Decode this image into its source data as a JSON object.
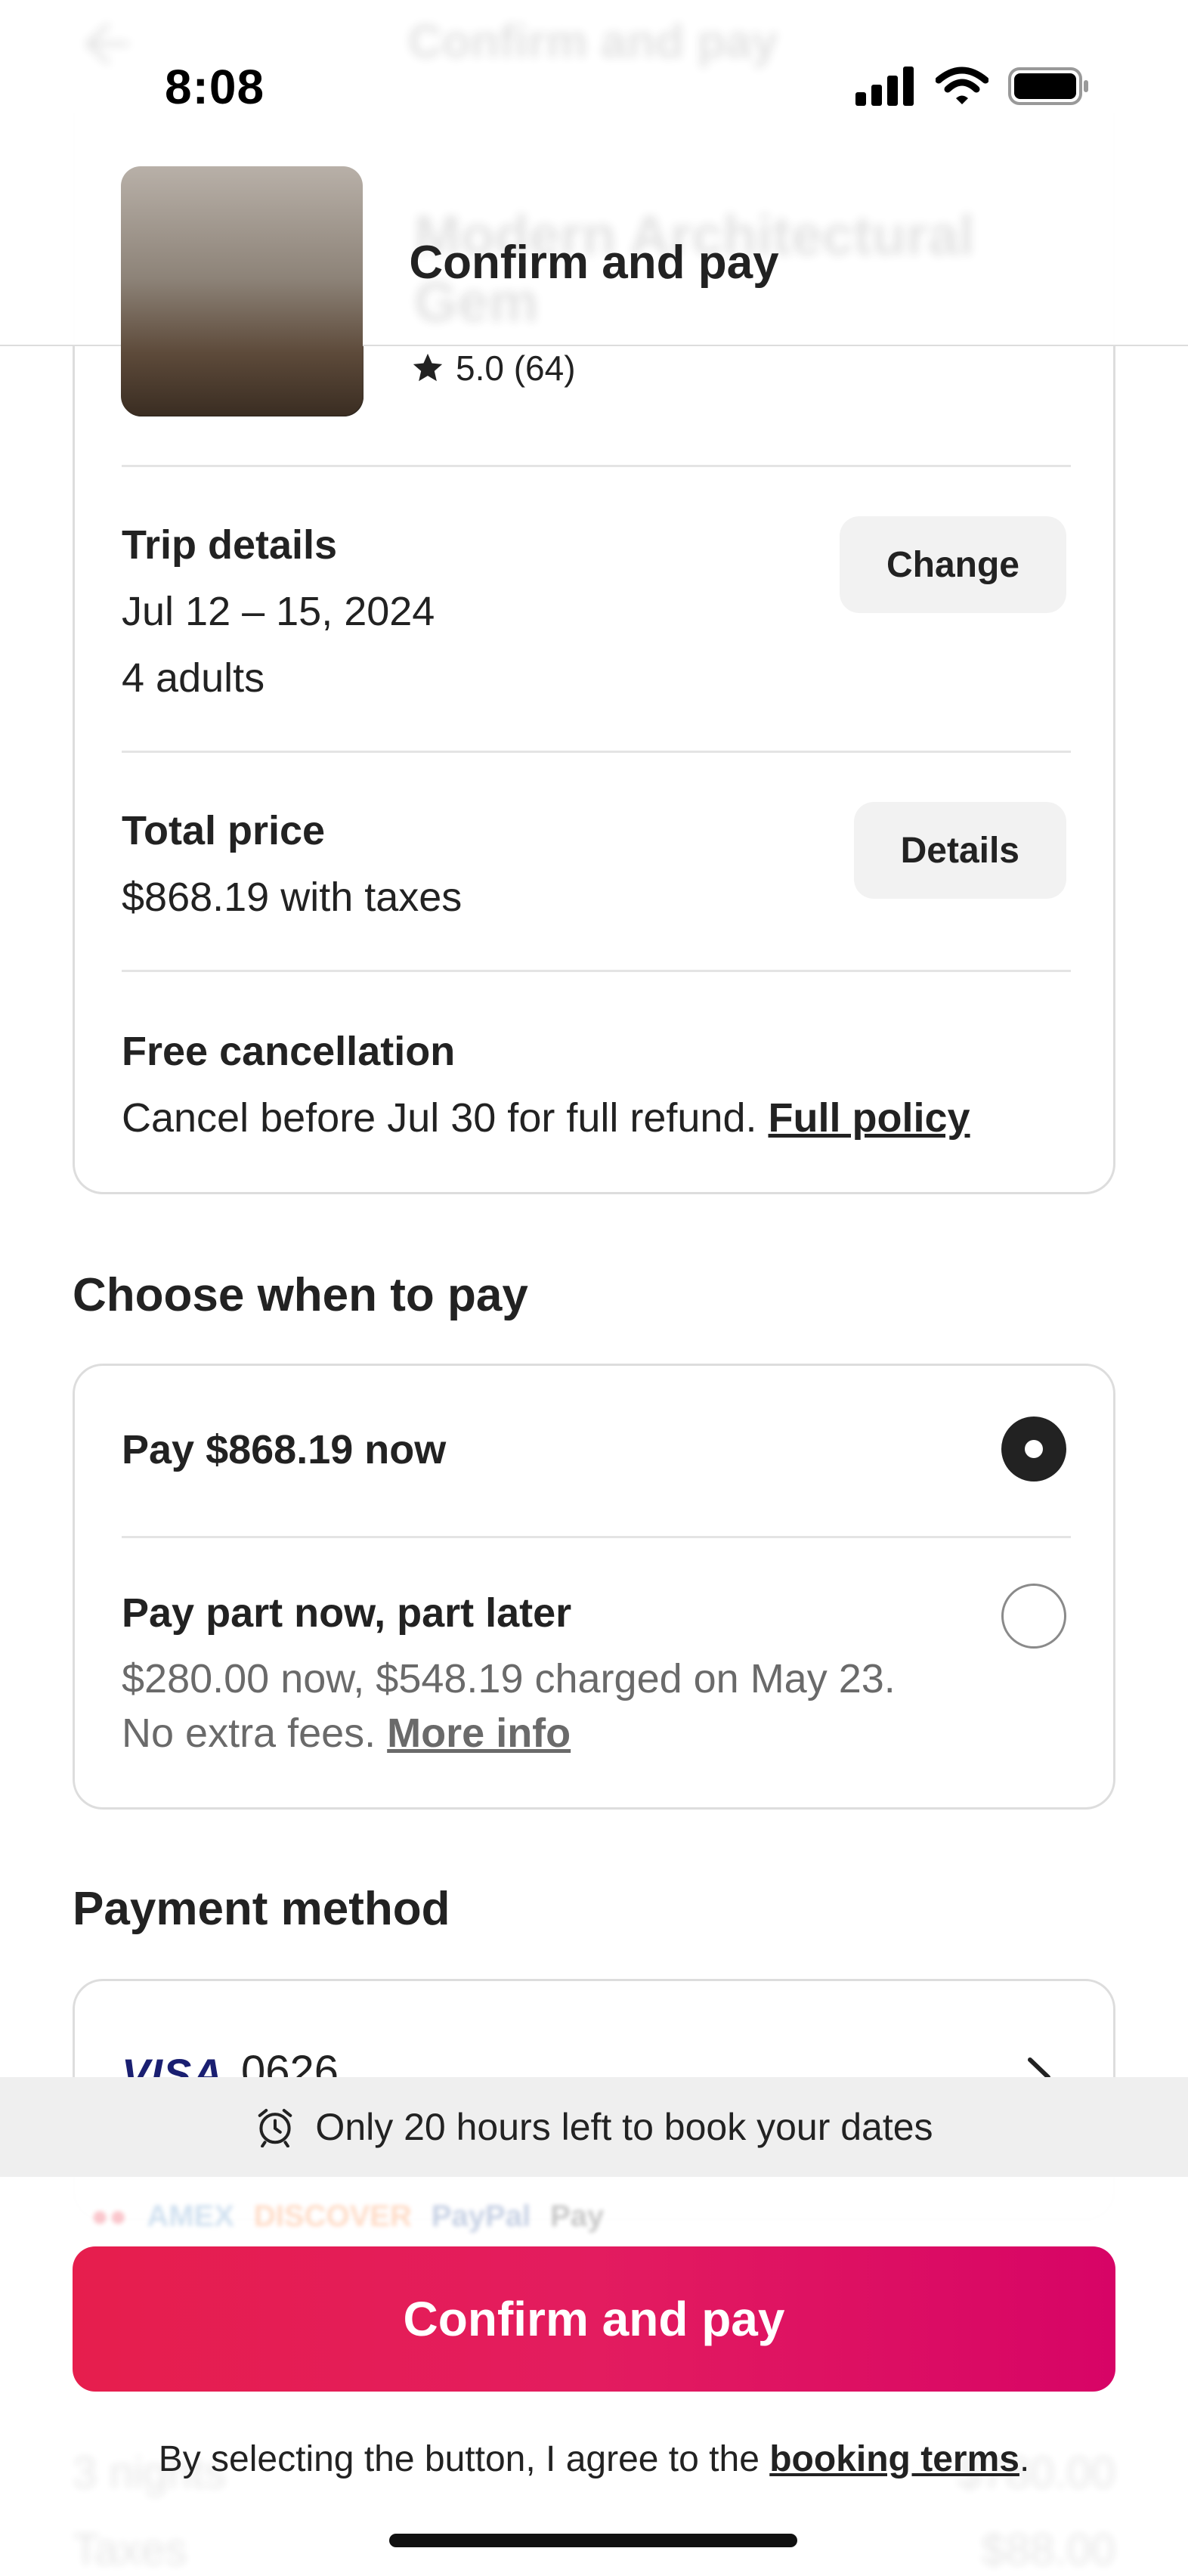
{
  "status_bar": {
    "time": "8:08"
  },
  "header": {
    "title": "Confirm and pay",
    "ghost_title": "Confirm and pay",
    "ghost_listing_name": "Modern Architectural Gem"
  },
  "listing": {
    "rating": "5.0 (64)"
  },
  "trip": {
    "title": "Trip details",
    "dates": "Jul 12 – 15, 2024",
    "guests": "4 adults",
    "change_label": "Change"
  },
  "price": {
    "title": "Total price",
    "value": "$868.19 with taxes",
    "details_label": "Details"
  },
  "cancellation": {
    "title": "Free cancellation",
    "text": "Cancel before Jul 30 for full refund.",
    "policy_link": "Full policy"
  },
  "pay_when": {
    "title": "Choose when to pay",
    "option_full": "Pay $868.19 now",
    "option_partial": "Pay part now, part later",
    "option_partial_line1": "$280.00 now, $548.19 charged on May 23.",
    "option_partial_line2": "No extra fees.",
    "more_info": "More info",
    "selected": "full"
  },
  "payment_method": {
    "title": "Payment method",
    "brand": "VISA",
    "last4": "0626"
  },
  "notice": {
    "text": "Only 20 hours left to book your dates"
  },
  "footer": {
    "cta_label": "Confirm and pay",
    "terms_prefix": "By selecting the button, I agree to the",
    "terms_link": "booking terms",
    "terms_suffix": ".",
    "ghost_row1_label": "3 nights",
    "ghost_row1_value": "$780.00",
    "ghost_row2_label": "Taxes",
    "ghost_row2_value": "$88.00"
  },
  "colors": {
    "brand": "#e31c5f",
    "text": "#222222",
    "muted": "#6a6a6a",
    "border": "#dddddd"
  }
}
